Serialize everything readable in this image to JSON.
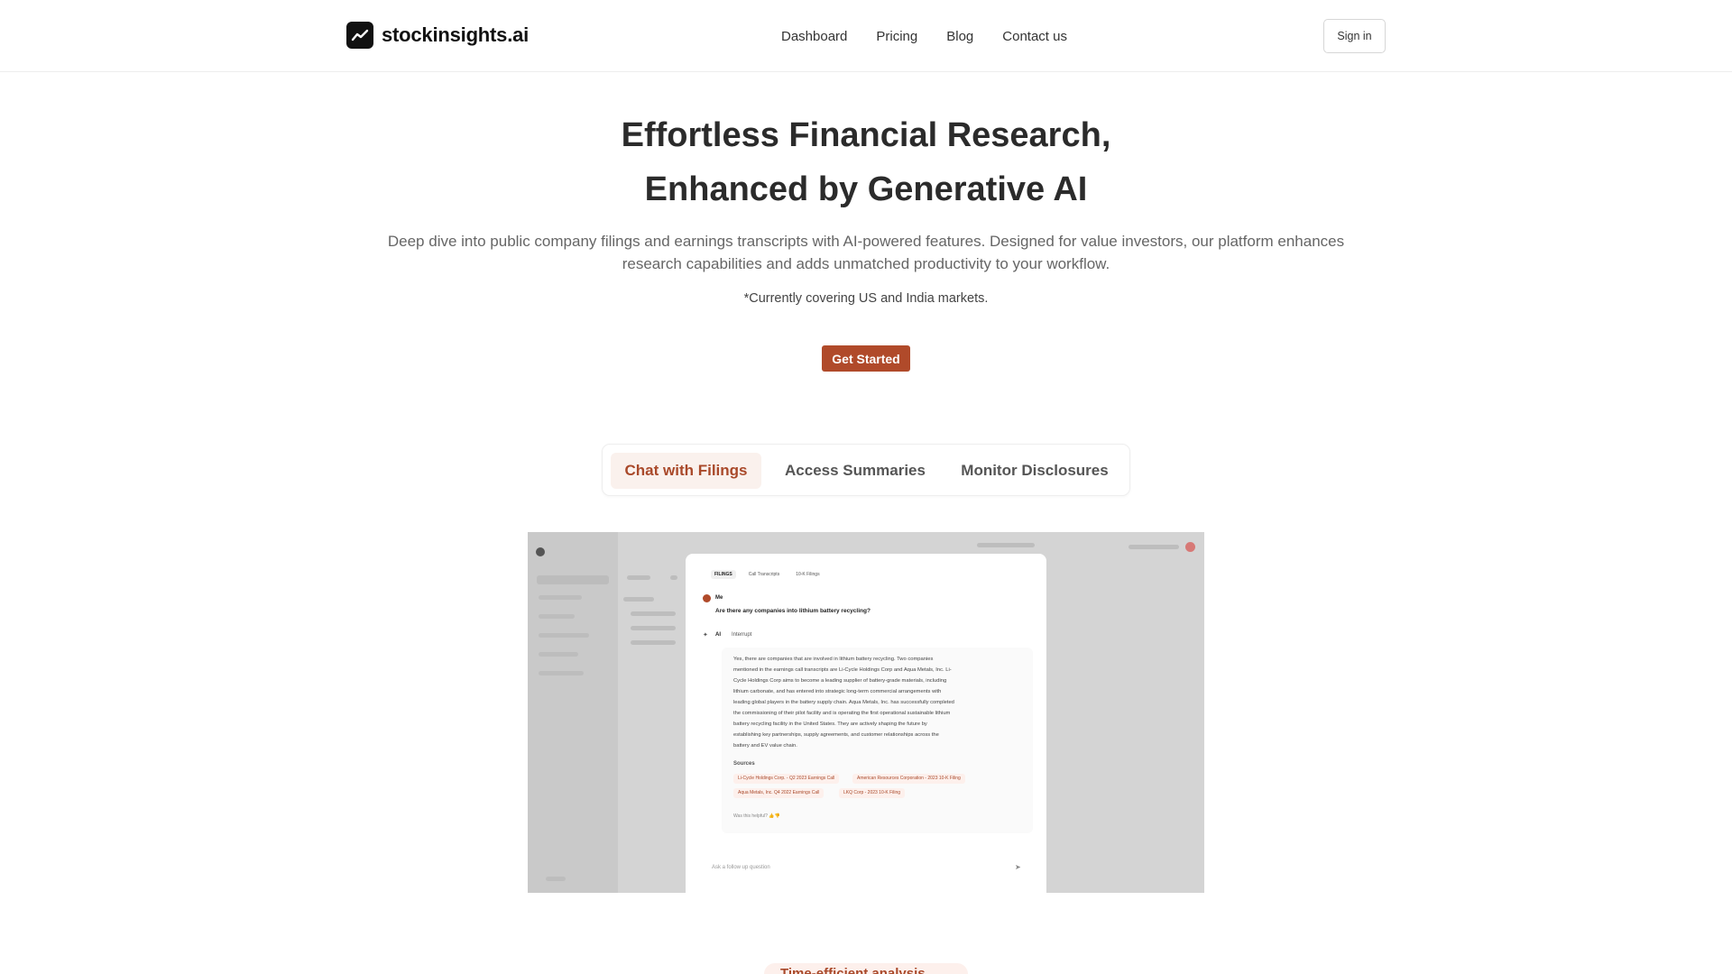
{
  "header": {
    "logo_text": "stockinsights.ai",
    "logo_icon": "trending-up-icon",
    "nav": [
      {
        "label": "Dashboard"
      },
      {
        "label": "Pricing"
      },
      {
        "label": "Blog"
      },
      {
        "label": "Contact us"
      }
    ],
    "signin_label": "Sign in"
  },
  "hero": {
    "title_line1": "Effortless Financial Research,",
    "title_line2": "Enhanced by Generative AI",
    "subtitle_line1": "Deep dive into public company filings and earnings transcripts with AI-powered features. Designed for value investors, our platform enhances",
    "subtitle_line2": "research capabilities and adds unmatched productivity to your workflow.",
    "note": "*Currently covering US and India markets.",
    "cta_label": "Get Started"
  },
  "tabs": [
    {
      "label": "Chat with Filings",
      "active": true
    },
    {
      "label": "Access Summaries",
      "active": false
    },
    {
      "label": "Monitor Disclosures",
      "active": false
    }
  ],
  "preview": {
    "panel_tabs": [
      "FILINGS",
      "Call Transcripts",
      "10-K Filings"
    ],
    "me_label": "Me",
    "question": "Are there any companies into lithium battery recycling?",
    "ai_label": "AI",
    "interrupt_label": "Interrupt",
    "answer_lines": [
      "Yes, there are companies that are involved in lithium battery recycling. Two companies",
      "mentioned in the earnings call transcripts are Li-Cycle Holdings Corp and Aqua Metals, Inc. Li-",
      "Cycle Holdings Corp aims to become a leading supplier of battery-grade materials, including",
      "lithium carbonate, and has entered into strategic long-term commercial arrangements with",
      "leading global players in the battery supply chain. Aqua Metals, Inc. has successfully completed",
      "the commissioning of their pilot facility and is operating the first operational sustainable lithium",
      "battery recycling facility in the United States. They are actively shaping the future by",
      "establishing key partnerships, supply agreements, and customer relationships across the",
      "battery and EV value chain."
    ],
    "sources_label": "Sources",
    "sources": [
      "Li-Cycle Holdings Corp. - Q2 2023 Earnings Call",
      "American Resources Corporation - 2023 10-K Filing",
      "Aqua Metals, Inc. Q4 2022 Earnings Call",
      "LKQ Corp - 2023 10-K Filing"
    ],
    "helpful_text": "Was this helpful?",
    "followup_placeholder": "Ask a follow up question",
    "send_icon": "send-icon"
  },
  "bottom_badge": "Time-efficient analysis",
  "colors": {
    "accent": "#b04a2a",
    "accent_soft": "#faf1ed",
    "text_dark": "#2b2b2b",
    "text_muted": "#666666"
  }
}
